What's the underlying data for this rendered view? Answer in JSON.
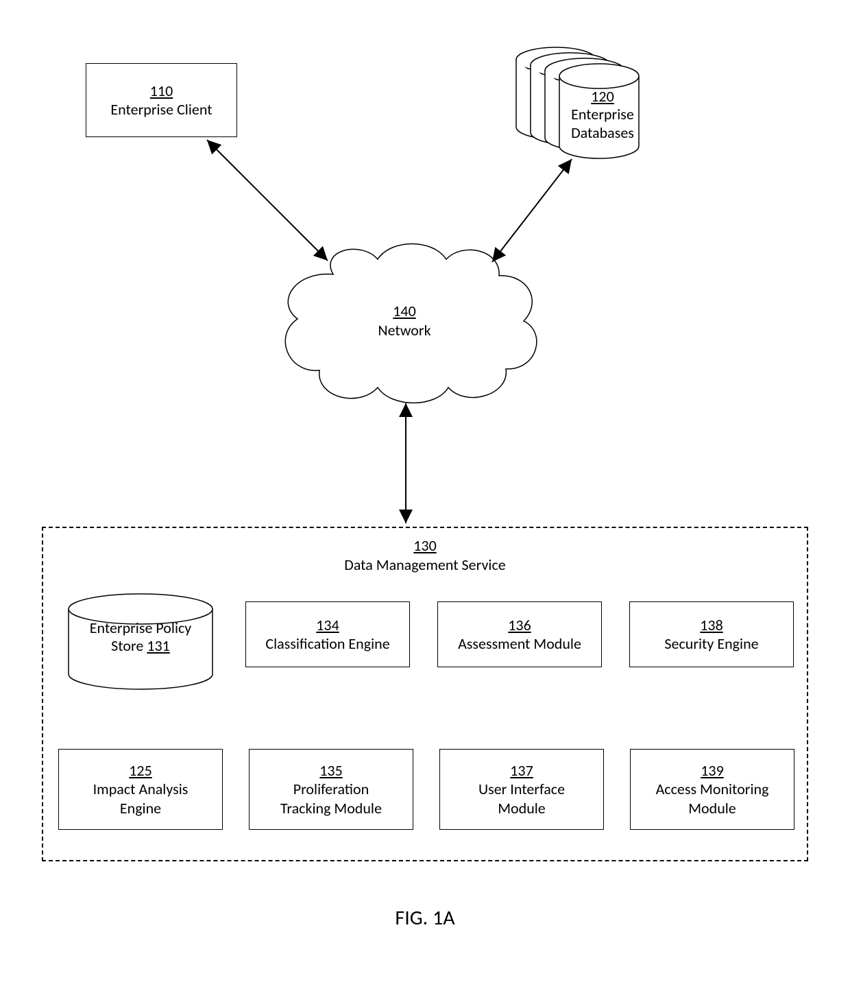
{
  "enterpriseClient": {
    "num": "110",
    "label": "Enterprise Client"
  },
  "enterpriseDatabases": {
    "num": "120",
    "label": "Enterprise\nDatabases"
  },
  "network": {
    "num": "140",
    "label": "Network"
  },
  "dms": {
    "num": "130",
    "label": "Data Management Service"
  },
  "modules": {
    "policyStore": {
      "label": "Enterprise Policy\nStore",
      "num": "131"
    },
    "classification": {
      "num": "134",
      "label": "Classification Engine"
    },
    "assessment": {
      "num": "136",
      "label": "Assessment Module"
    },
    "security": {
      "num": "138",
      "label": "Security Engine"
    },
    "impact": {
      "num": "125",
      "label": "Impact Analysis\nEngine"
    },
    "proliferation": {
      "num": "135",
      "label": "Proliferation\nTracking Module"
    },
    "ui": {
      "num": "137",
      "label": "User Interface\nModule"
    },
    "access": {
      "num": "139",
      "label": "Access Monitoring\nModule"
    }
  },
  "figure": "FIG. 1A"
}
